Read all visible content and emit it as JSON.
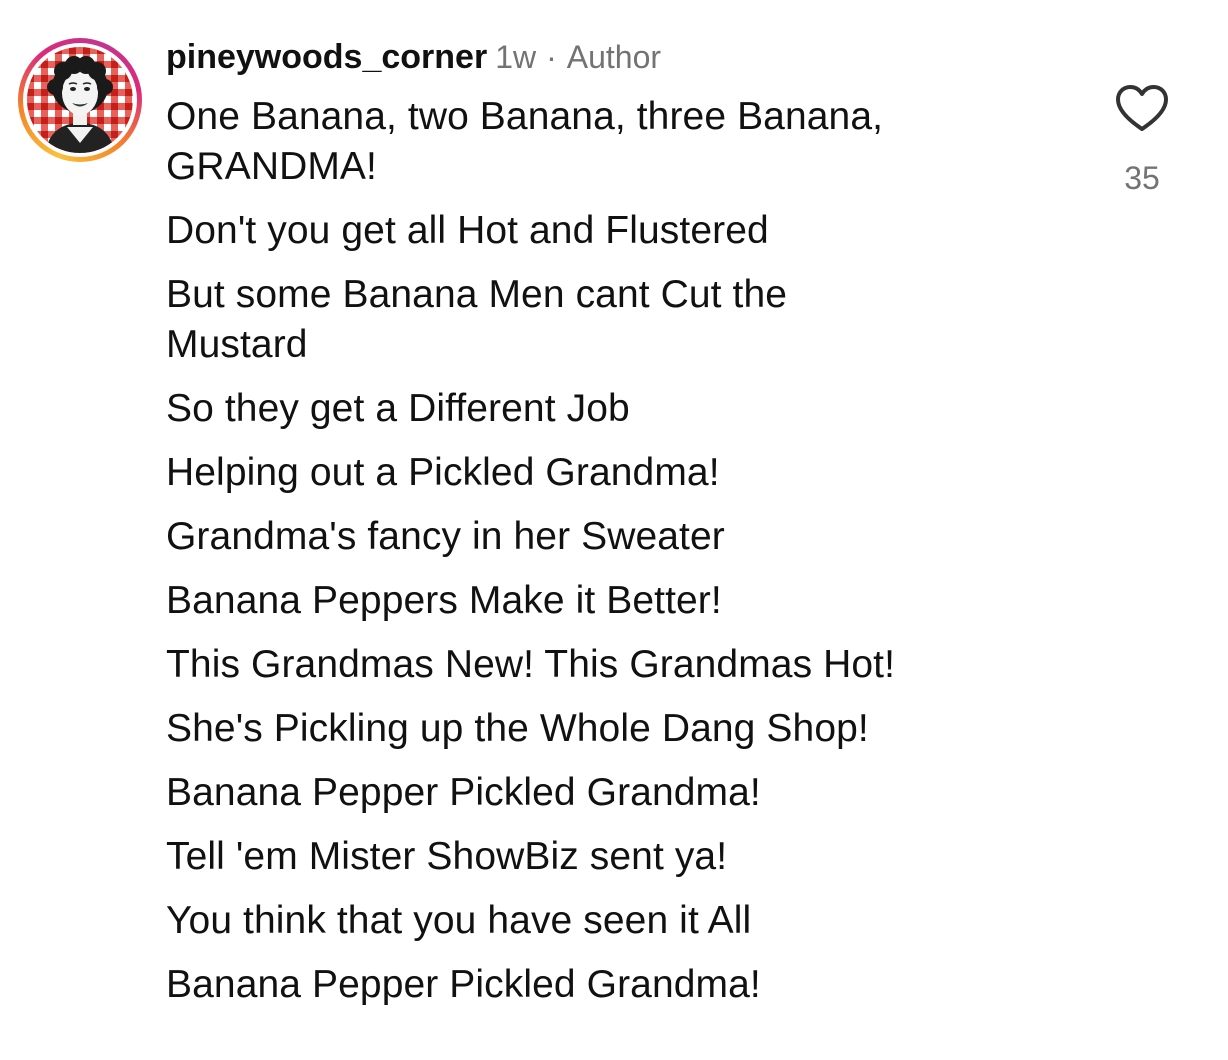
{
  "comment": {
    "username": "pineywoods_corner",
    "time_ago": "1w",
    "separator": "·",
    "author_badge": "Author",
    "lines": [
      "One Banana, two Banana, three Banana,\nGRANDMA!",
      "Don't you get all Hot and Flustered",
      "But some Banana Men cant Cut the\nMustard",
      "So they get a Different Job",
      "Helping out a Pickled Grandma!",
      "Grandma's fancy in her Sweater",
      "Banana Peppers Make it Better!",
      "This Grandmas New! This Grandmas Hot!",
      "She's Pickling up the Whole Dang Shop!",
      "Banana Pepper Pickled Grandma!",
      "Tell 'em Mister ShowBiz sent ya!",
      "You think that you have seen it All",
      "Banana Pepper Pickled Grandma!"
    ],
    "like_count": "35",
    "like_icon": "heart-outline-icon"
  },
  "colors": {
    "text": "#111111",
    "secondary": "#737373",
    "avatar_ring": [
      "#f9c23c",
      "#f58529",
      "#dd2a7b"
    ],
    "avatar_check_red": "#d9312b"
  }
}
